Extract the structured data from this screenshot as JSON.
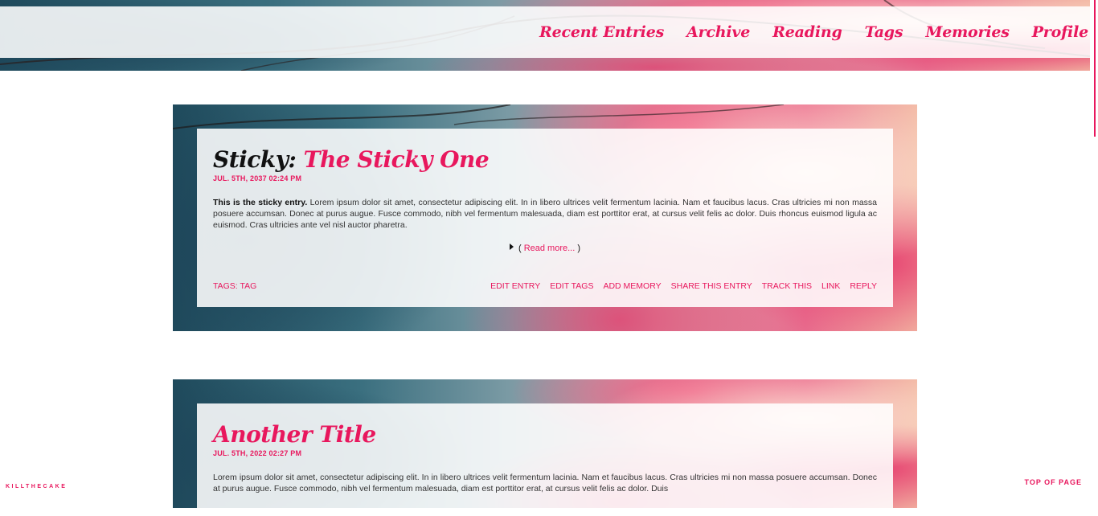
{
  "nav": {
    "items": [
      "Recent Entries",
      "Archive",
      "Reading",
      "Tags",
      "Memories",
      "Profile"
    ]
  },
  "entries": [
    {
      "title_prefix": "Sticky:",
      "title": "The Sticky One",
      "date": "JUL. 5TH, 2037 02:24 PM",
      "body_bold": "This is the sticky entry.",
      "body": "Lorem ipsum dolor sit amet, consectetur adipiscing elit. In in libero ultrices velit fermentum lacinia. Nam et faucibus lacus. Cras ultricies mi non massa posuere accumsan. Donec at purus augue. Fusce commodo, nibh vel fermentum malesuada, diam est porttitor erat, at cursus velit felis ac dolor. Duis rhoncus euismod ligula ac euismod. Cras ultricies ante vel nisl auctor pharetra.",
      "read_more_open": "(",
      "read_more": "Read more...",
      "read_more_close": ")",
      "tags": "TAGS: TAG",
      "actions": [
        "EDIT ENTRY",
        "EDIT TAGS",
        "ADD MEMORY",
        "SHARE THIS ENTRY",
        "TRACK THIS",
        "LINK",
        "REPLY"
      ]
    },
    {
      "title": "Another Title",
      "date": "JUL. 5TH, 2022 02:27 PM",
      "body": "Lorem ipsum dolor sit amet, consectetur adipiscing elit. In in libero ultrices velit fermentum lacinia. Nam et faucibus lacus. Cras ultricies mi non massa posuere accumsan. Donec at purus augue. Fusce commodo, nibh vel fermentum malesuada, diam est porttitor erat, at cursus velit felis ac dolor. Duis"
    }
  ],
  "footer": {
    "brand": "KILLTHECAKE",
    "top_of_page": "TOP OF PAGE"
  },
  "colors": {
    "accent": "#e8175d",
    "background": "#ffffff"
  }
}
